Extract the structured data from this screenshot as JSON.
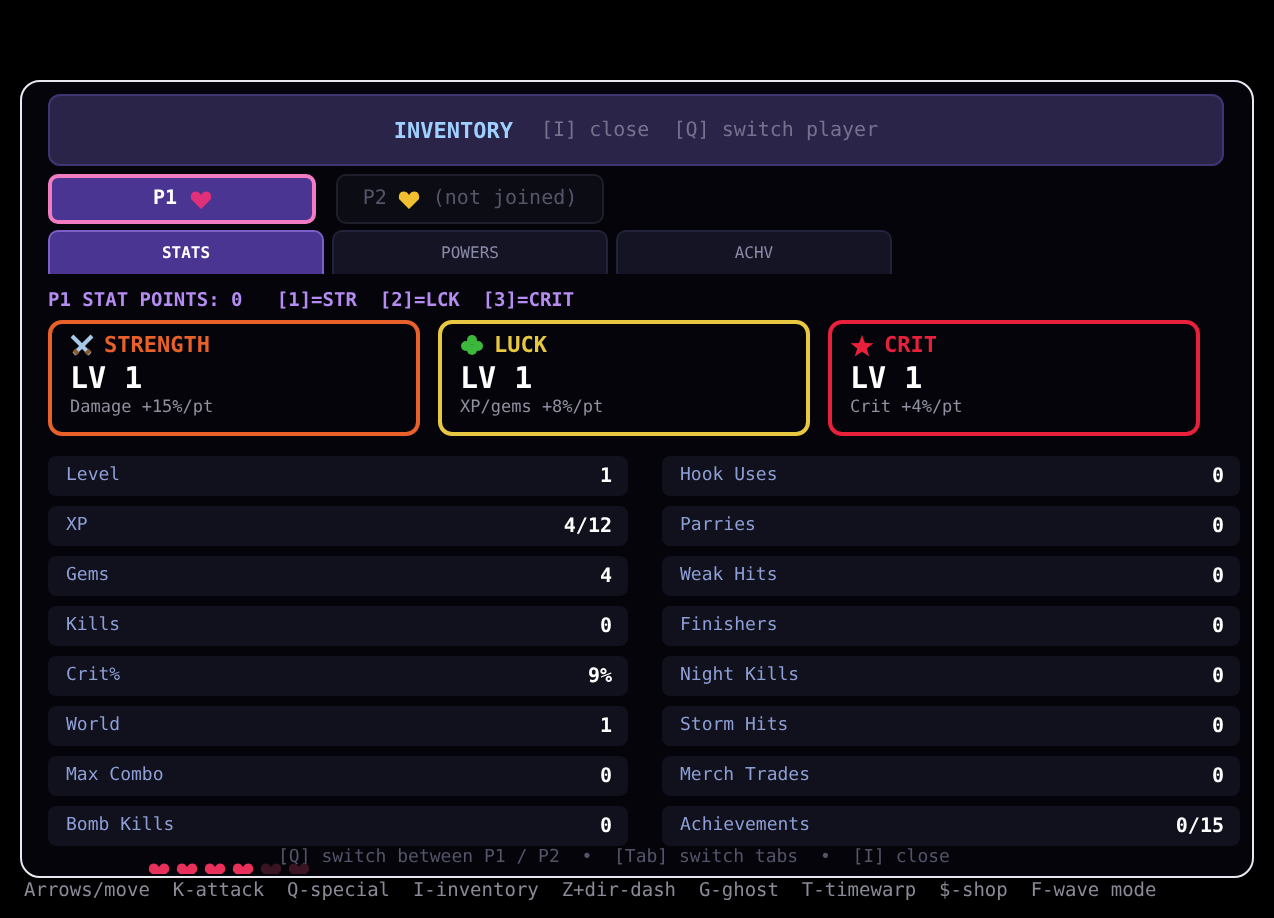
{
  "header": {
    "title": "INVENTORY",
    "hint": "[I] close  [Q] switch player"
  },
  "players": [
    {
      "label": "P1",
      "color": "#e0307a",
      "selected": true
    },
    {
      "label": "P2",
      "color": "#f0c030",
      "suffix": "(not joined)",
      "selected": false
    }
  ],
  "tabs": [
    {
      "label": "STATS",
      "selected": true
    },
    {
      "label": "POWERS",
      "selected": false
    },
    {
      "label": "ACHV",
      "selected": false
    }
  ],
  "stat_points": "P1 STAT POINTS: 0   [1]=STR  [2]=LCK  [3]=CRIT",
  "cards": [
    {
      "kind": "sword",
      "name": "STRENGTH",
      "color": "#e8602a",
      "level": "LV 1",
      "desc": "Damage +15%/pt"
    },
    {
      "kind": "clover",
      "name": "LUCK",
      "color": "#e8c840",
      "level": "LV 1",
      "desc": "XP/gems +8%/pt"
    },
    {
      "kind": "star",
      "name": "CRIT",
      "color": "#e8203c",
      "level": "LV 1",
      "desc": "Crit +4%/pt"
    }
  ],
  "stats_left": [
    {
      "label": "Level",
      "value": "1"
    },
    {
      "label": "XP",
      "value": "4/12"
    },
    {
      "label": "Gems",
      "value": "4"
    },
    {
      "label": "Kills",
      "value": "0"
    },
    {
      "label": "Crit%",
      "value": "9%"
    },
    {
      "label": "World",
      "value": "1"
    },
    {
      "label": "Max Combo",
      "value": "0"
    },
    {
      "label": "Bomb Kills",
      "value": "0"
    }
  ],
  "stats_right": [
    {
      "label": "Hook Uses",
      "value": "0"
    },
    {
      "label": "Parries",
      "value": "0"
    },
    {
      "label": "Weak Hits",
      "value": "0"
    },
    {
      "label": "Finishers",
      "value": "0"
    },
    {
      "label": "Night Kills",
      "value": "0"
    },
    {
      "label": "Storm Hits",
      "value": "0"
    },
    {
      "label": "Merch Trades",
      "value": "0"
    },
    {
      "label": "Achievements",
      "value": "0/15"
    }
  ],
  "footer_hint": "[Q] switch between P1 / P2  •  [Tab] switch tabs  •  [I] close",
  "hearts": [
    {
      "filled": true
    },
    {
      "filled": true
    },
    {
      "filled": true
    },
    {
      "filled": true
    },
    {
      "filled": false
    },
    {
      "filled": false
    }
  ],
  "controls": "Arrows/move  K-attack  Q-special  I-inventory  Z+dir-dash  G-ghost  T-timewarp  $-shop  F-wave mode"
}
